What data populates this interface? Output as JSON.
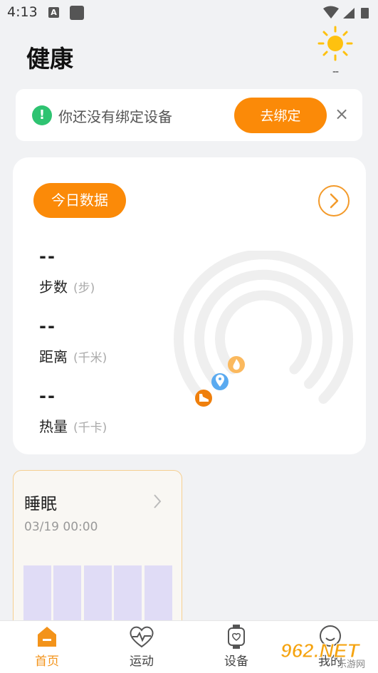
{
  "status_bar": {
    "time": "4:13",
    "notification_letter": "A"
  },
  "header": {
    "title": "健康",
    "weather_icon": "sun-icon",
    "weather_text": "--"
  },
  "bind_device": {
    "message": "你还没有绑定设备",
    "button_label": "去绑定",
    "close_label": "×"
  },
  "today": {
    "pill_label": "今日数据",
    "metrics": [
      {
        "value": "--",
        "label": "步数",
        "unit": "(步)"
      },
      {
        "value": "--",
        "label": "距离",
        "unit": "(千米)"
      },
      {
        "value": "--",
        "label": "热量",
        "unit": "(千卡)"
      }
    ]
  },
  "sleep": {
    "title": "睡眠",
    "date": "03/19 00:00"
  },
  "bottom_nav": [
    {
      "label": "首页",
      "icon": "home-icon",
      "active": true
    },
    {
      "label": "运动",
      "icon": "heart-pulse-icon",
      "active": false
    },
    {
      "label": "设备",
      "icon": "watch-icon",
      "active": false
    },
    {
      "label": "我的",
      "icon": "profile-icon",
      "active": false
    }
  ],
  "watermark": {
    "text": "962.NET",
    "subtext": "乐游网"
  },
  "colors": {
    "accent": "#fb8a08",
    "success": "#2ec371",
    "ring": "#f0f0f0"
  }
}
